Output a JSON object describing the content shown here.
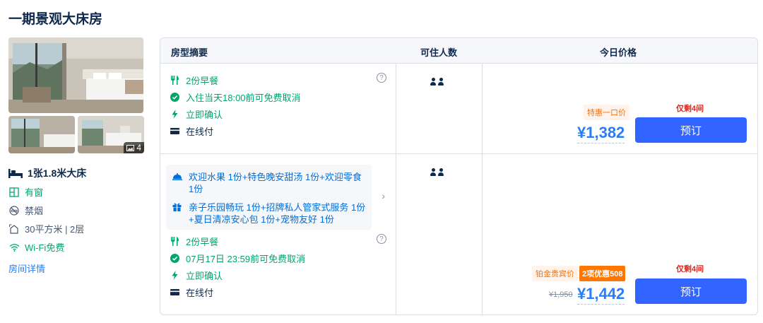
{
  "room": {
    "title": "一期景观大床房",
    "photo_count": "4",
    "bed": "1张1.8米大床",
    "features": [
      {
        "icon": "window-icon",
        "label": "有窗",
        "highlight": true
      },
      {
        "icon": "no-smoking-icon",
        "label": "禁烟",
        "highlight": false
      },
      {
        "icon": "area-icon",
        "label": "30平方米 | 2层",
        "highlight": false
      },
      {
        "icon": "wifi-icon",
        "label": "Wi-Fi免费",
        "highlight": true
      }
    ],
    "detail_link": "房间详情"
  },
  "table": {
    "headers": {
      "summary": "房型摘要",
      "occupancy": "可住人数",
      "price": "今日价格"
    }
  },
  "offers": [
    {
      "breakfast": "2份早餐",
      "cancel": "入住当天18:00前可免费取消",
      "confirm": "立即确认",
      "payment": "在线付",
      "info": "?",
      "remaining": "仅剩4间",
      "tag": "特惠一口价",
      "price": "¥1,382",
      "button": "预订",
      "guests": 2
    },
    {
      "gifts": [
        {
          "icon": "service-bell-icon",
          "text": "欢迎水果 1份+特色晚安甜汤 1份+欢迎零食 1份"
        },
        {
          "icon": "gift-icon",
          "text": "亲子乐园畅玩 1份+招牌私人管家式服务 1份+夏日清凉安心包 1份+宠物友好 1份"
        }
      ],
      "gift_chevron": "›",
      "breakfast": "2份早餐",
      "cancel": "07月17日 23:59前可免费取消",
      "confirm": "立即确认",
      "payment": "在线付",
      "info": "?",
      "remaining": "仅剩4间",
      "tag": "铂金贵宾价",
      "promo": "2项优惠508",
      "original_price": "¥1,950",
      "price": "¥1,442",
      "button": "预订",
      "guests": 2
    }
  ],
  "colors": {
    "accent_blue": "#287dfa",
    "button_blue": "#3264ff",
    "green": "#00a66a",
    "red": "#e1251b",
    "orange": "#ff7700"
  }
}
